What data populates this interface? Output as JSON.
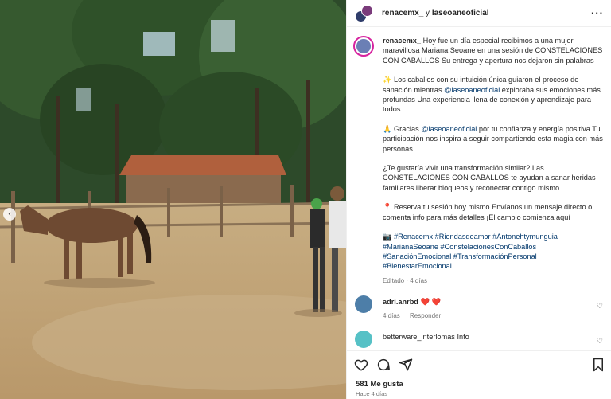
{
  "header": {
    "user1": "renacemx_",
    "joiner": " y ",
    "user2": "laseoaneoficial"
  },
  "caption": {
    "username": "renacemx_",
    "p1": "Hoy fue un día especial recibimos a una mujer maravillosa Mariana Seoane en una sesión de CONSTELACIONES CON CABALLOS Su entrega y apertura nos dejaron sin palabras",
    "p2_emoji": "✨",
    "p2_a": "Los caballos con su intuición única guiaron el proceso de sanación mientras",
    "p2_mention": "@laseoaneoficial",
    "p2_b": "exploraba sus emociones más profundas Una experiencia llena de conexión y aprendizaje para todos",
    "p3_emoji": "🙏",
    "p3_a": "Gracias",
    "p3_mention": "@laseoaneoficial",
    "p3_b": "por tu confianza y energía positiva Tu participación nos inspira a seguir compartiendo esta magia con más personas",
    "p4": "¿Te gustaría vivir una transformación similar? Las CONSTELACIONES CON CABALLOS te ayudan a sanar heridas familiares liberar bloqueos y reconectar contigo mismo",
    "p5_emoji": "📍",
    "p5": "Reserva tu sesión hoy mismo Envíanos un mensaje directo o comenta info para más detalles ¡El cambio comienza aquí",
    "tags_emoji": "📷",
    "tags": "#Renacemx #Riendasdeamor #Antonehtymunguia #MarianaSeoane #ConstelacionesConCaballos #SanaciónEmocional #TransformaciónPersonal #BienestarEmocional",
    "meta": "Editado · 4 días"
  },
  "comments": [
    {
      "username": "adri.anrbd",
      "text": "❤️ ❤️",
      "time": "4 días",
      "reply": "Responder"
    },
    {
      "username": "betterware_interlomas",
      "text": "Info",
      "time": "",
      "reply": ""
    }
  ],
  "footer": {
    "likes": "581 Me gusta",
    "ago": "Hace 4 días"
  },
  "icons": {
    "more": "more-icon",
    "nav_left": "chevron-left-icon",
    "like": "heart-icon",
    "comment": "comment-icon",
    "share": "share-icon",
    "save": "bookmark-icon"
  }
}
